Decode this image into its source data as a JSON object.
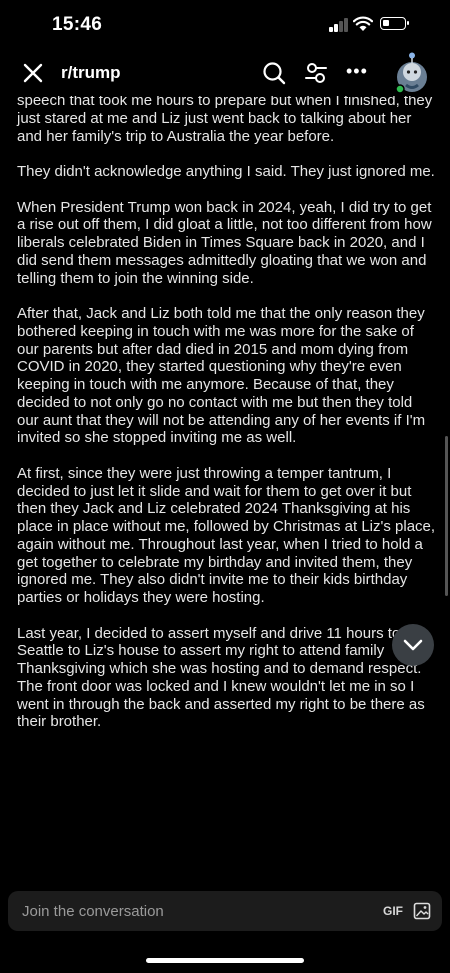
{
  "status_bar": {
    "time": "15:46",
    "battery_level": 0.3
  },
  "nav": {
    "subreddit": "r/trump"
  },
  "post": {
    "paragraphs": [
      "speech that took me hours to prepare but when I finished, they just stared at me and Liz just went back to talking about her and her family's trip to Australia the year before.",
      "They didn't acknowledge anything I said. They just ignored me.",
      "When President Trump won back in 2024, yeah, I did try to get a rise out off them, I did gloat a little, not too different from how liberals celebrated Biden in Times Square back in 2020, and I did send them messages admittedly gloating that we won and telling them to join the winning side.",
      "After that, Jack and Liz both told me that the only reason they bothered keeping in touch with me was more for the sake of our parents but after dad died in 2015 and mom dying from COVID in 2020, they started questioning why they're even keeping in touch with me anymore. Because of that, they decided to not only go no contact with me but then they told our aunt that they will not be attending any of her events if I'm invited so she stopped inviting me as well.",
      "At first, since they were just throwing a temper tantrum, I decided to just let it slide and wait for them to get over it but then they Jack and Liz celebrated 2024 Thanksgiving at his place in place without me, followed by Christmas at Liz's place, again without me. Throughout last year, when I tried to hold a get together to celebrate my birthday and invited them, they ignored me. They also didn't invite me to their kids birthday parties or holidays they were hosting.",
      "Last year, I decided to assert myself and drive 11 hours to Seattle to Liz's house to assert my right to attend family Thanksgiving which she was hosting and to demand respect. The front door was locked and I knew wouldn't let me in so I went in through the back and asserted my right to be there as their brother."
    ]
  },
  "composer": {
    "placeholder": "Join the conversation",
    "gif_label": "GIF"
  },
  "icons": {
    "close": "close-icon",
    "search": "search-icon",
    "filter": "filter-icon",
    "more": "more-icon",
    "jump": "chevron-down-icon",
    "image": "image-icon"
  },
  "colors": {
    "background": "#000000",
    "text": "#e6e6e6",
    "composer": "#1c1c1c",
    "jump_button": "#3a3f44"
  }
}
